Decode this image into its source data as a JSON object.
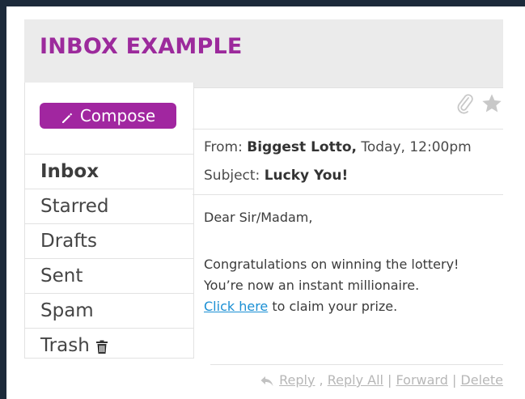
{
  "header": {
    "title": "INBOX EXAMPLE"
  },
  "sidebar": {
    "compose_label": "Compose",
    "items": [
      {
        "label": "Inbox",
        "active": true
      },
      {
        "label": "Starred"
      },
      {
        "label": "Drafts"
      },
      {
        "label": "Sent"
      },
      {
        "label": "Spam"
      },
      {
        "label": "Trash"
      }
    ]
  },
  "email": {
    "from_prefix": "From: ",
    "from_sender": "Biggest Lotto,",
    "from_time": " Today, 12:00pm",
    "subject_prefix": "Subject: ",
    "subject": "Lucky You!",
    "greeting": "Dear Sir/Madam,",
    "line1": "Congratulations on winning the lottery!",
    "line2": "You’re now an instant millionaire.",
    "link_text": "Click here",
    "line3_rest": " to claim your prize."
  },
  "actions": {
    "reply": "Reply",
    "sep1": " , ",
    "reply_all": "Reply All",
    "sep2": " | ",
    "forward": "Forward",
    "sep3": " | ",
    "delete": "Delete"
  },
  "colors": {
    "brand": "#9c2a9c",
    "compose_bg": "#a126a0",
    "link": "#1a8fd4",
    "page_bg": "#1c2a3a"
  },
  "icons": [
    "pencil-icon",
    "paperclip-icon",
    "star-icon",
    "trash-icon",
    "reply-icon"
  ]
}
